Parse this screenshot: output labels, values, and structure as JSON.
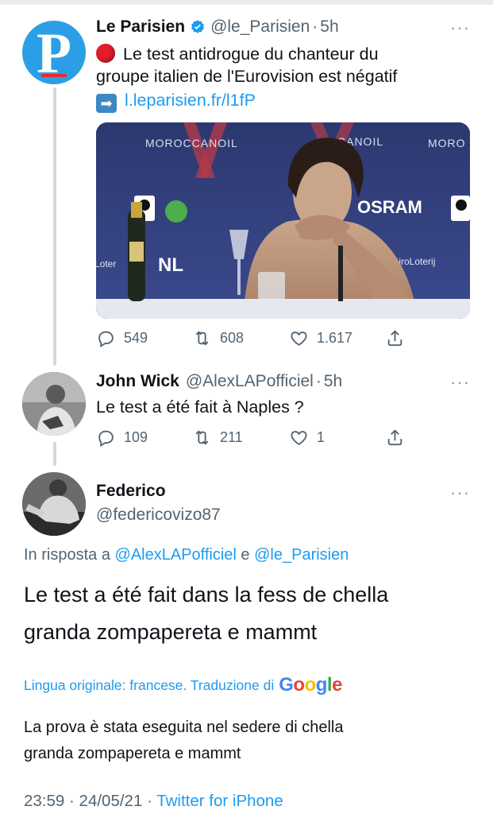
{
  "tweets": [
    {
      "name": "Le Parisien",
      "handle": "@le_Parisien",
      "separator": "·",
      "time": "5h",
      "logo_letter": "P",
      "line1": "Le test antidrogue du chanteur du",
      "line2": "groupe italien de l'Eurovision est négatif",
      "link": "l.leparisien.fr/l1fP",
      "media": {
        "banner_left": "MOROCCANOIL",
        "banner_mid": "CANOIL",
        "banner_right": "MORO",
        "sponsor": "OSRAM",
        "nl": "NL",
        "bottom_right": "kGiroLoterij",
        "bottom_left": "Loter",
        "wwf": "WWF"
      },
      "replies": "549",
      "retweets": "608",
      "likes": "1.617"
    },
    {
      "name": "John Wick",
      "handle": "@AlexLAPofficiel",
      "separator": "·",
      "time": "5h",
      "text": "Le test a été fait à Naples ?",
      "replies": "109",
      "retweets": "211",
      "likes": "1"
    }
  ],
  "main": {
    "name": "Federico",
    "handle": "@federicovizo87",
    "reply_to_prefix": "In risposta a",
    "reply_to_user1": "@AlexLAPofficiel",
    "reply_to_and": "e",
    "reply_to_user2": "@le_Parisien",
    "text_line1": "Le test a été fait dans la fess de chella",
    "text_line2": "granda zompapereta e mammt",
    "translate_label": "Lingua originale: francese. Traduzione di",
    "google": [
      "G",
      "o",
      "o",
      "g",
      "l",
      "e"
    ],
    "translation_line1": "La prova è stata eseguita nel sedere di chella",
    "translation_line2": "granda zompapereta e mammt",
    "time": "23:59",
    "date": "24/05/21",
    "separator": "·",
    "source": "Twitter for iPhone"
  },
  "more_icon": "···",
  "icons": [
    "verified-badge-icon",
    "red-circle-emoji-icon",
    "right-arrow-emoji-icon",
    "reply-icon",
    "retweet-icon",
    "like-icon",
    "share-icon",
    "more-options-icon"
  ],
  "colors": {
    "accent": "#1d9bf0",
    "muted": "#536471",
    "thread_line": "#cfd9de",
    "logo_blue": "#2b9fe6",
    "logo_red": "#e62a2e"
  }
}
